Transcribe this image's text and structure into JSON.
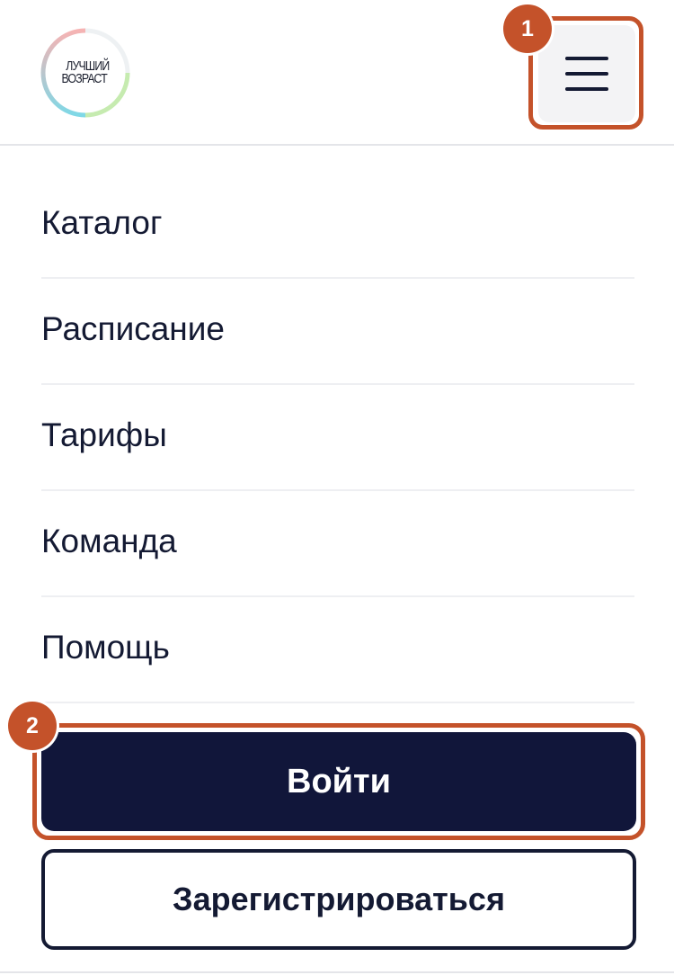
{
  "logo": {
    "line1": "Лучший",
    "line2": "возраст"
  },
  "header": {
    "menu_icon": "hamburger-menu-icon"
  },
  "badges": {
    "first": "1",
    "second": "2"
  },
  "nav": {
    "items": [
      {
        "label": "Каталог"
      },
      {
        "label": "Расписание"
      },
      {
        "label": "Тарифы"
      },
      {
        "label": "Команда"
      },
      {
        "label": "Помощь"
      }
    ]
  },
  "actions": {
    "login_label": "Войти",
    "register_label": "Зарегистрироваться"
  },
  "colors": {
    "highlight": "#c4522a",
    "primary": "#11163a",
    "text": "#141a33",
    "menu_button_bg": "#f3f3f5"
  }
}
